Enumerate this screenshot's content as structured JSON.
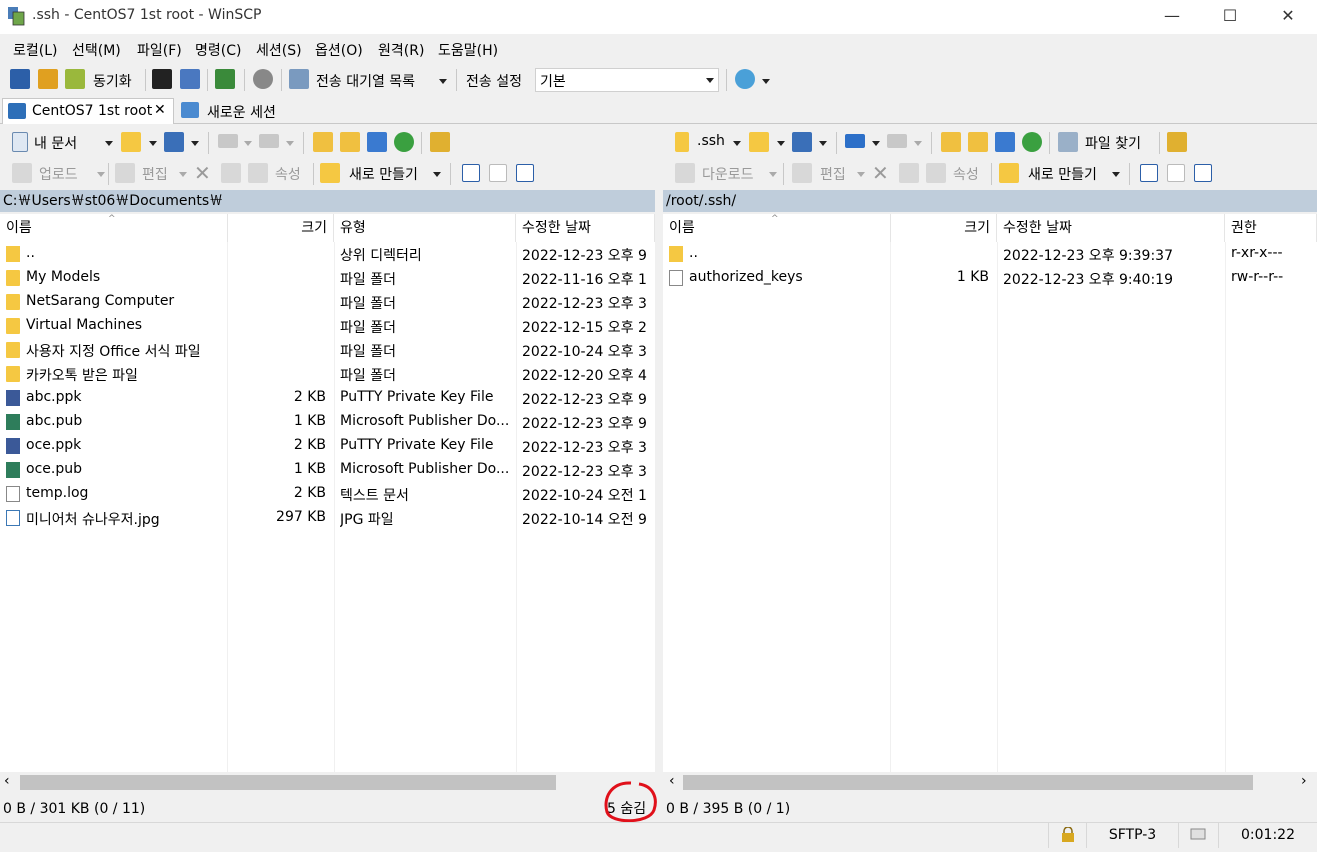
{
  "window": {
    "title": ".ssh - CentOS7 1st root - WinSCP",
    "minimize": "—",
    "maximize": "☐",
    "close": "✕"
  },
  "menu": [
    "로컬(L)",
    "선택(M)",
    "파일(F)",
    "명령(C)",
    "세션(S)",
    "옵션(O)",
    "원격(R)",
    "도움말(H)"
  ],
  "toolbar": {
    "sync_label": "동기화",
    "queue_label": "전송 대기열 목록",
    "transfer_settings_label": "전송 설정",
    "transfer_settings_value": "기본"
  },
  "tabs": {
    "session": "CentOS7 1st root",
    "session_close": "✕",
    "new_session": "새로운 세션"
  },
  "local": {
    "location": "내 문서",
    "upload_label": "업로드",
    "edit_label": "편집",
    "properties_label": "속성",
    "new_label": "새로 만들기",
    "path": "C:￦Users￦st06￦Documents￦",
    "columns": [
      "이름",
      "크기",
      "유형",
      "수정한 날짜"
    ],
    "files": [
      {
        "name": "..",
        "size": "",
        "type": "상위 디렉터리",
        "date": "2022-12-23  오후 9",
        "icon": "updir"
      },
      {
        "name": "My Models",
        "size": "",
        "type": "파일 폴더",
        "date": "2022-11-16  오후 1",
        "icon": "folder"
      },
      {
        "name": "NetSarang Computer",
        "size": "",
        "type": "파일 폴더",
        "date": "2022-12-23  오후 3",
        "icon": "folder"
      },
      {
        "name": "Virtual Machines",
        "size": "",
        "type": "파일 폴더",
        "date": "2022-12-15  오후 2",
        "icon": "folder"
      },
      {
        "name": "사용자 지정 Office 서식 파일",
        "size": "",
        "type": "파일 폴더",
        "date": "2022-10-24  오후 3",
        "icon": "folder"
      },
      {
        "name": "카카오톡 받은 파일",
        "size": "",
        "type": "파일 폴더",
        "date": "2022-12-20  오후 4",
        "icon": "folder"
      },
      {
        "name": "abc.ppk",
        "size": "2 KB",
        "type": "PuTTY Private Key File",
        "date": "2022-12-23  오후 9",
        "icon": "ppk"
      },
      {
        "name": "abc.pub",
        "size": "1 KB",
        "type": "Microsoft Publisher Do...",
        "date": "2022-12-23  오후 9",
        "icon": "pub"
      },
      {
        "name": "oce.ppk",
        "size": "2 KB",
        "type": "PuTTY Private Key File",
        "date": "2022-12-23  오후 3",
        "icon": "ppk"
      },
      {
        "name": "oce.pub",
        "size": "1 KB",
        "type": "Microsoft Publisher Do...",
        "date": "2022-12-23  오후 3",
        "icon": "pub"
      },
      {
        "name": "temp.log",
        "size": "2 KB",
        "type": "텍스트 문서",
        "date": "2022-10-24  오전 1",
        "icon": "doc"
      },
      {
        "name": "미니어처 슈나우저.jpg",
        "size": "297 KB",
        "type": "JPG 파일",
        "date": "2022-10-14  오전 9",
        "icon": "jpg"
      }
    ],
    "status": "0 B / 301 KB (0 / 11)",
    "hidden": "5 숨김"
  },
  "remote": {
    "location": ".ssh",
    "download_label": "다운로드",
    "edit_label": "편집",
    "properties_label": "속성",
    "new_label": "새로 만들기",
    "find_label": "파일 찾기",
    "path": "/root/.ssh/",
    "columns": [
      "이름",
      "크기",
      "수정한 날짜",
      "권한"
    ],
    "files": [
      {
        "name": "..",
        "size": "",
        "date": "2022-12-23  오후 9:39:37",
        "perm": "r-xr-x---",
        "icon": "updir"
      },
      {
        "name": "authorized_keys",
        "size": "1 KB",
        "date": "2022-12-23  오후 9:40:19",
        "perm": "rw-r--r--",
        "icon": "doc"
      }
    ],
    "status": "0 B / 395 B (0 / 1)"
  },
  "statusbar": {
    "protocol": "SFTP-3",
    "elapsed": "0:01:22"
  },
  "colors": {
    "path_bar": "#bfcddb",
    "annotation": "#e0101a",
    "scroll_thumb": "#c2c2c2"
  }
}
